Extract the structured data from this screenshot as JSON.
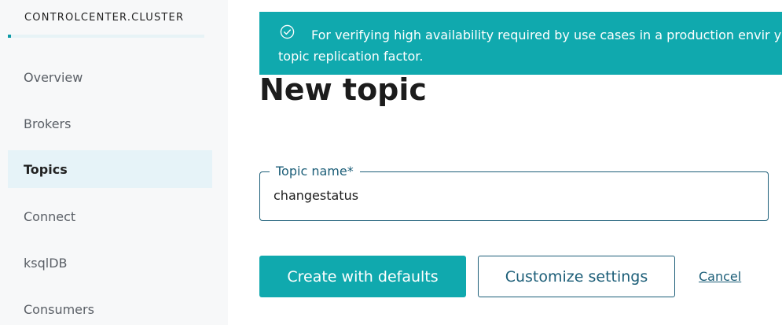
{
  "sidebar": {
    "cluster_name": "CONTROLCENTER.CLUSTER",
    "items": [
      {
        "label": "Overview"
      },
      {
        "label": "Brokers"
      },
      {
        "label": "Topics",
        "active": true
      },
      {
        "label": "Connect"
      },
      {
        "label": "ksqlDB"
      },
      {
        "label": "Consumers"
      }
    ]
  },
  "banner": {
    "icon": "check-circle-icon",
    "text": "For verifying high availability required by use cases in a production envir your topic replication factor."
  },
  "page": {
    "title": "New topic"
  },
  "form": {
    "topic_name_label": "Topic name*",
    "topic_name_value": "changestatus"
  },
  "actions": {
    "create_label": "Create with defaults",
    "customize_label": "Customize settings",
    "cancel_label": "Cancel"
  },
  "colors": {
    "accent": "#10a9ae",
    "dark_accent": "#1c5e78",
    "active_nav_bg": "#e6f3f8"
  }
}
